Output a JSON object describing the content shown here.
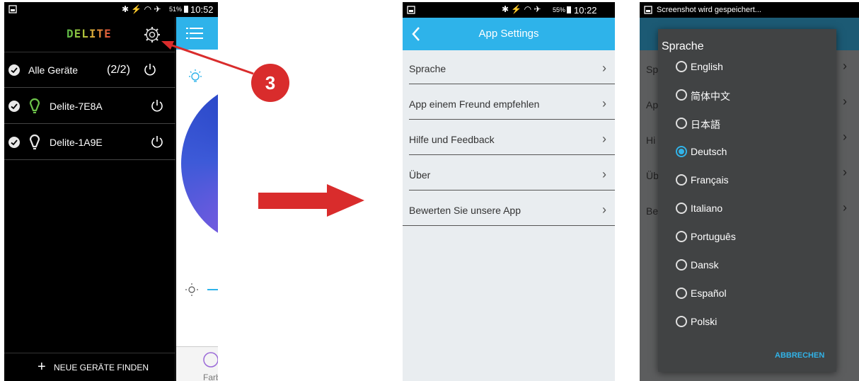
{
  "screen1": {
    "status": {
      "battery_pct": "51%",
      "time": "10:52"
    },
    "logo": "DELITE",
    "rows": [
      {
        "name": "Alle Geräte",
        "count": "(2/2)"
      },
      {
        "name": "Delite-7E8A",
        "bulb_color": "#6cc24a"
      },
      {
        "name": "Delite-1A9E",
        "bulb_color": "#e8e8e8"
      }
    ],
    "find_devices": "NEUE GERÄTE FINDEN",
    "tab_label": "Farb"
  },
  "annotation": {
    "badge": "3",
    "color": "#d92c2c"
  },
  "screen2": {
    "status": {
      "battery_pct": "55%",
      "time": "10:22"
    },
    "title": "App Settings",
    "items": [
      {
        "label": "Sprache"
      },
      {
        "label": "App einem Freund empfehlen"
      },
      {
        "label": "Hilfe und Feedback"
      },
      {
        "label": "Über"
      },
      {
        "label": "Bewerten Sie unsere App"
      }
    ]
  },
  "screen3": {
    "status_message": "Screenshot wird gespeichert...",
    "bg_items": [
      "Sp",
      "Ap",
      "Hi",
      "Üb",
      "Be"
    ],
    "dialog_title": "Sprache",
    "options": [
      {
        "label": "English",
        "selected": false
      },
      {
        "label": "简体中文",
        "selected": false
      },
      {
        "label": "日本語",
        "selected": false
      },
      {
        "label": "Deutsch",
        "selected": true
      },
      {
        "label": "Français",
        "selected": false
      },
      {
        "label": "Italiano",
        "selected": false
      },
      {
        "label": "Português",
        "selected": false
      },
      {
        "label": "Dansk",
        "selected": false
      },
      {
        "label": "Español",
        "selected": false
      },
      {
        "label": "Polski",
        "selected": false
      }
    ],
    "cancel_label": "ABBRECHEN",
    "accent": "#31b3e8"
  },
  "colors": {
    "brand_blue": "#2eb3ea",
    "arrow_red": "#d92c2c"
  }
}
